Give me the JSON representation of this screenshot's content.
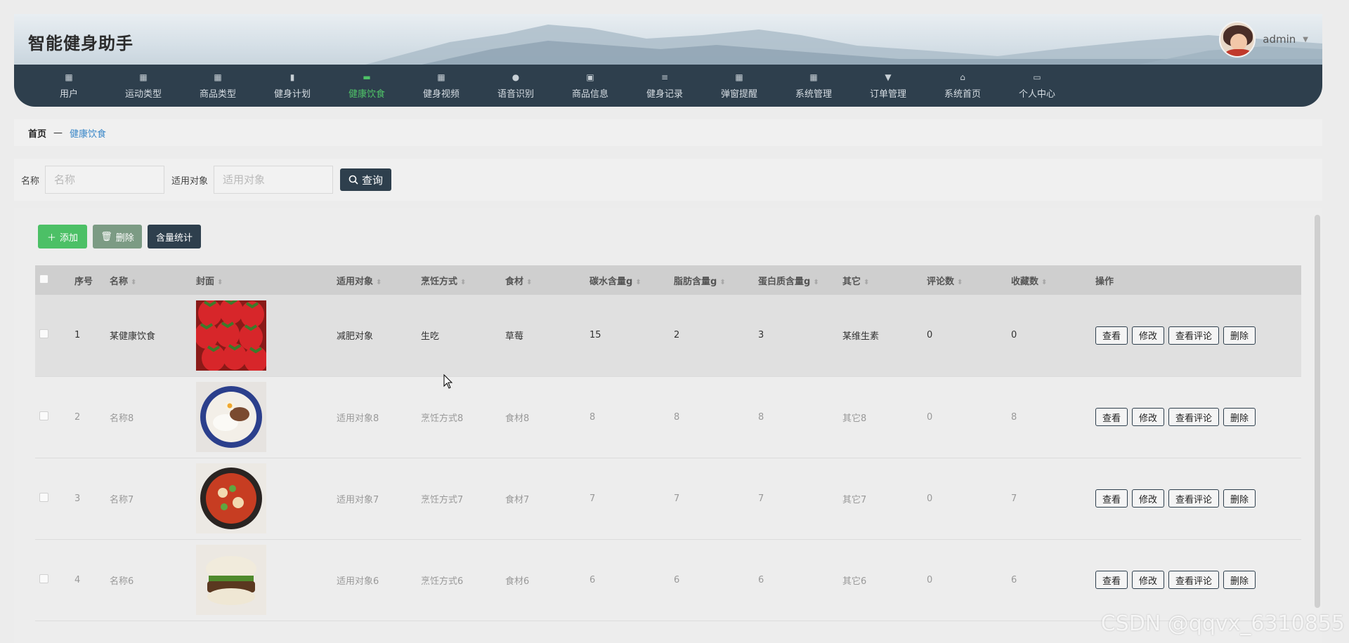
{
  "header": {
    "title": "智能健身助手",
    "username": "admin"
  },
  "nav": [
    {
      "label": "用户",
      "icon": "grid-icon"
    },
    {
      "label": "运动类型",
      "icon": "grid-icon"
    },
    {
      "label": "商品类型",
      "icon": "grid-icon"
    },
    {
      "label": "健身计划",
      "icon": "bar-chart-icon"
    },
    {
      "label": "健康饮食",
      "icon": "chat-icon",
      "active": true
    },
    {
      "label": "健身视频",
      "icon": "grid-icon"
    },
    {
      "label": "语音识别",
      "icon": "user-icon"
    },
    {
      "label": "商品信息",
      "icon": "briefcase-icon"
    },
    {
      "label": "健身记录",
      "icon": "sliders-icon"
    },
    {
      "label": "弹窗提醒",
      "icon": "grid-icon"
    },
    {
      "label": "系统管理",
      "icon": "grid-icon"
    },
    {
      "label": "订单管理",
      "icon": "pin-icon"
    },
    {
      "label": "系统首页",
      "icon": "home-icon"
    },
    {
      "label": "个人中心",
      "icon": "card-icon"
    }
  ],
  "breadcrumb": {
    "home": "首页",
    "sep": "—",
    "current": "健康饮食"
  },
  "search": {
    "name_label": "名称",
    "name_placeholder": "名称",
    "target_label": "适用对象",
    "target_placeholder": "适用对象",
    "query_label": "查询"
  },
  "toolbar": {
    "add": "添加",
    "delete": "删除",
    "stats": "含量统计"
  },
  "table": {
    "headers": [
      "序号",
      "名称",
      "封面",
      "适用对象",
      "烹饪方式",
      "食材",
      "碳水含量g",
      "脂肪含量g",
      "蛋白质含量g",
      "其它",
      "评论数",
      "收藏数",
      "操作"
    ],
    "ops": [
      "查看",
      "修改",
      "查看评论",
      "删除"
    ],
    "rows": [
      {
        "no": "1",
        "name": "某健康饮食",
        "target": "减肥对象",
        "cook": "生吃",
        "food": "草莓",
        "carb": "15",
        "fat": "2",
        "protein": "3",
        "other": "某维生素",
        "comments": "0",
        "favs": "0",
        "cover": "strawberry"
      },
      {
        "no": "2",
        "name": "名称8",
        "target": "适用对象8",
        "cook": "烹饪方式8",
        "food": "食材8",
        "carb": "8",
        "fat": "8",
        "protein": "8",
        "other": "其它8",
        "comments": "0",
        "favs": "8",
        "cover": "rice-plate"
      },
      {
        "no": "3",
        "name": "名称7",
        "target": "适用对象7",
        "cook": "烹饪方式7",
        "food": "食材7",
        "carb": "7",
        "fat": "7",
        "protein": "7",
        "other": "其它7",
        "comments": "0",
        "favs": "7",
        "cover": "spicy-bowl"
      },
      {
        "no": "4",
        "name": "名称6",
        "target": "适用对象6",
        "cook": "烹饪方式6",
        "food": "食材6",
        "carb": "6",
        "fat": "6",
        "protein": "6",
        "other": "其它6",
        "comments": "0",
        "favs": "6",
        "cover": "burger"
      }
    ]
  },
  "watermark": "CSDN @qqvx_6310855"
}
